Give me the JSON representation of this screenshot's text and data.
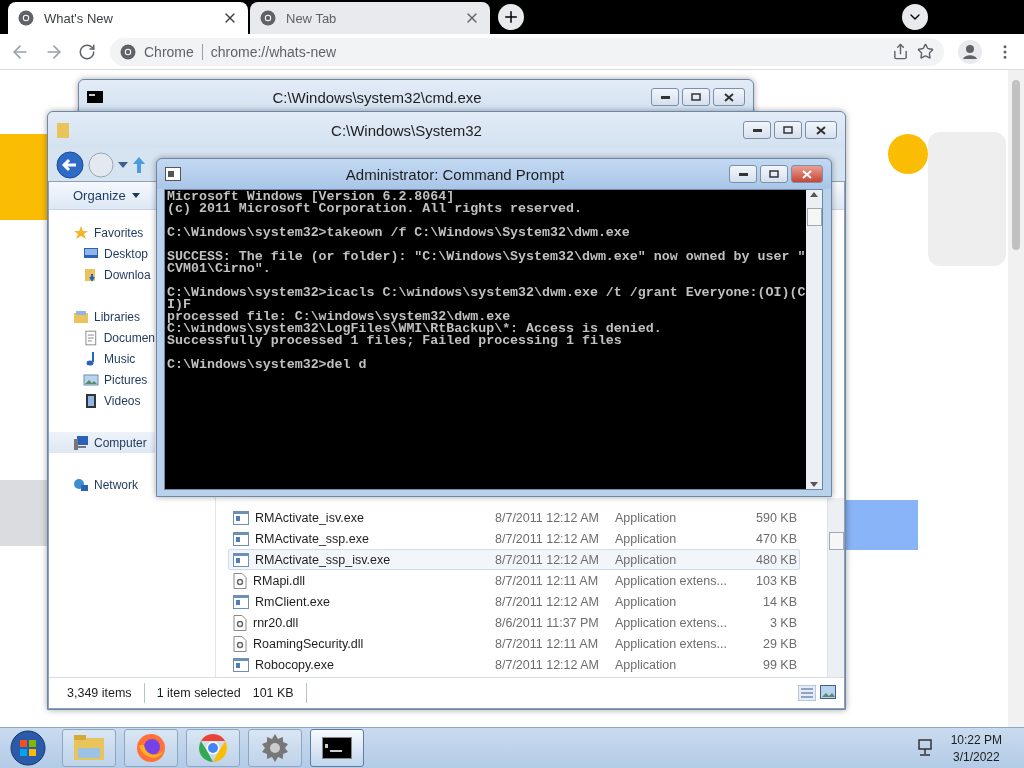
{
  "browser": {
    "tabs": [
      {
        "title": "What's New",
        "selected": true
      },
      {
        "title": "New Tab",
        "selected": false
      }
    ],
    "omnibox": {
      "site_label": "Chrome",
      "url": "chrome://whats-new"
    }
  },
  "back_window": {
    "title": "C:\\Windows\\system32\\cmd.exe",
    "active": false
  },
  "explorer": {
    "title": "C:\\Windows\\System32",
    "active": false,
    "toolbar_button": "Organize",
    "nav_pane": [
      {
        "label": "Favorites",
        "kind": "star",
        "selected": false,
        "children": [
          {
            "label": "Desktop",
            "kind": "desktop",
            "selected": false
          },
          {
            "label": "Downloa",
            "kind": "download",
            "selected": false
          }
        ]
      },
      {
        "label": "Libraries",
        "kind": "library",
        "selected": false,
        "children": [
          {
            "label": "Documen",
            "kind": "document",
            "selected": false
          },
          {
            "label": "Music",
            "kind": "music",
            "selected": false
          },
          {
            "label": "Pictures",
            "kind": "picture",
            "selected": false
          },
          {
            "label": "Videos",
            "kind": "video",
            "selected": false
          }
        ]
      },
      {
        "label": "Computer",
        "kind": "computer",
        "selected": true
      },
      {
        "label": "Network",
        "kind": "network",
        "selected": false
      }
    ],
    "files": [
      {
        "name": "RMActivate_isv.exe",
        "date": "8/7/2011 12:12 AM",
        "type": "Application",
        "size": "590 KB",
        "kind": "exe",
        "selected": false
      },
      {
        "name": "RMActivate_ssp.exe",
        "date": "8/7/2011 12:12 AM",
        "type": "Application",
        "size": "470 KB",
        "kind": "exe",
        "selected": false
      },
      {
        "name": "RMActivate_ssp_isv.exe",
        "date": "8/7/2011 12:12 AM",
        "type": "Application",
        "size": "480 KB",
        "kind": "exe",
        "selected": true
      },
      {
        "name": "RMapi.dll",
        "date": "8/7/2011 12:11 AM",
        "type": "Application extens...",
        "size": "103 KB",
        "kind": "dll",
        "selected": false
      },
      {
        "name": "RmClient.exe",
        "date": "8/7/2011 12:12 AM",
        "type": "Application",
        "size": "14 KB",
        "kind": "exe",
        "selected": false
      },
      {
        "name": "rnr20.dll",
        "date": "8/6/2011 11:37 PM",
        "type": "Application extens...",
        "size": "3 KB",
        "kind": "dll",
        "selected": false
      },
      {
        "name": "RoamingSecurity.dll",
        "date": "8/7/2011 12:11 AM",
        "type": "Application extens...",
        "size": "29 KB",
        "kind": "dll",
        "selected": false
      },
      {
        "name": "Robocopy.exe",
        "date": "8/7/2011 12:12 AM",
        "type": "Application",
        "size": "99 KB",
        "kind": "exe",
        "selected": false
      }
    ],
    "status": {
      "items": "3,349 items",
      "selection": "1 item selected",
      "size": "101 KB"
    }
  },
  "command_prompt": {
    "title": "Administrator: Command Prompt",
    "active": true,
    "blocks": [
      [
        "Microsoft Windows [Version 6.2.8064]",
        "(c) 2011 Microsoft Corporation. All rights reserved."
      ],
      [
        "C:\\Windows\\system32>takeown /f C:\\Windows\\System32\\dwm.exe"
      ],
      [
        "SUCCESS: The file (or folder): \"C:\\Windows\\System32\\dwm.exe\" now owned by user \"",
        "CVM01\\Cirno\"."
      ],
      [
        "C:\\Windows\\system32>icacls C:\\windows\\system32\\dwm.exe /t /grant Everyone:(OI)(C",
        "I)F",
        "processed file: C:\\windows\\system32\\dwm.exe",
        "C:\\windows\\system32\\LogFiles\\WMI\\RtBackup\\*: Access is denied.",
        "Successfully processed 1 files; Failed processing 1 files"
      ],
      [
        "C:\\Windows\\system32>del d"
      ]
    ]
  },
  "taskbar": {
    "items": [
      {
        "kind": "folder",
        "selected": false
      },
      {
        "kind": "firefox",
        "selected": false
      },
      {
        "kind": "chrome",
        "selected": false
      },
      {
        "kind": "gear",
        "selected": false
      },
      {
        "kind": "console",
        "selected": true
      }
    ],
    "time": "10:22 PM",
    "date": "3/1/2022"
  }
}
